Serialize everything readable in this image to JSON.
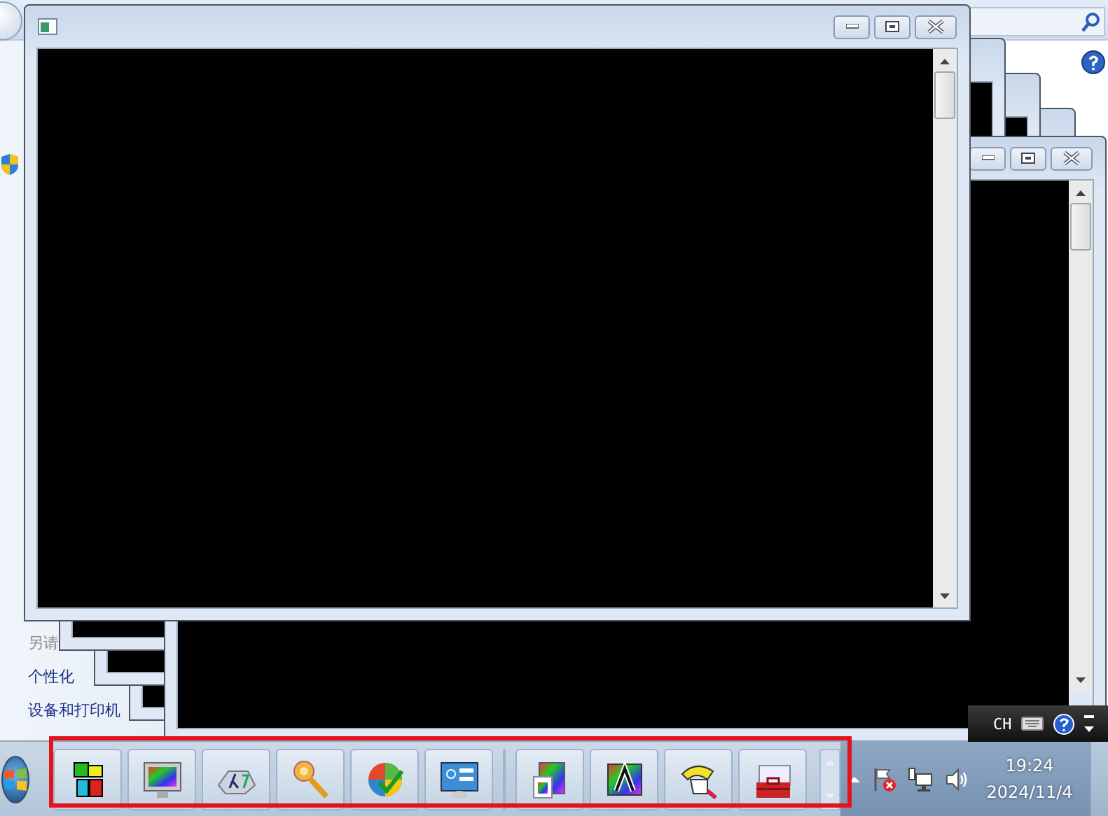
{
  "control_panel": {
    "sidebar_links": [
      {
        "label": "另请",
        "kind": "heading"
      },
      {
        "label": "个性化",
        "kind": "link"
      },
      {
        "label": "设备和打印机",
        "kind": "link"
      }
    ]
  },
  "language_bar": {
    "language": "CH"
  },
  "clock": {
    "time": "19:24",
    "date": "2024/11/4"
  }
}
